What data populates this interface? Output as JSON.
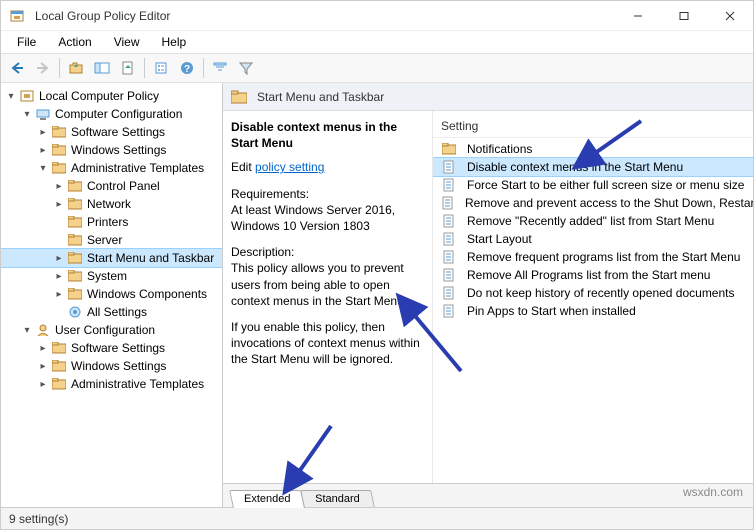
{
  "window": {
    "title": "Local Group Policy Editor"
  },
  "menus": [
    "File",
    "Action",
    "View",
    "Help"
  ],
  "tree": {
    "root": "Local Computer Policy",
    "computer": "Computer Configuration",
    "cc_soft": "Software Settings",
    "cc_win": "Windows Settings",
    "cc_adm": "Administrative Templates",
    "adm_cp": "Control Panel",
    "adm_net": "Network",
    "adm_prn": "Printers",
    "adm_srv": "Server",
    "adm_start": "Start Menu and Taskbar",
    "adm_sys": "System",
    "adm_wc": "Windows Components",
    "adm_all": "All Settings",
    "user": "User Configuration",
    "uc_soft": "Software Settings",
    "uc_win": "Windows Settings",
    "uc_adm": "Administrative Templates"
  },
  "header": "Start Menu and Taskbar",
  "desc": {
    "title": "Disable context menus in the Start Menu",
    "edit_prefix": "Edit ",
    "edit_link": "policy setting",
    "req_h": "Requirements:",
    "req_1": "At least Windows Server 2016,",
    "req_2": "Windows 10 Version 1803",
    "d_h": "Description:",
    "d_1": "This policy allows you to prevent users from being able to open context menus in the Start Menu.",
    "d_2": "If you enable this policy, then invocations of context menus within the Start Menu will be ignored."
  },
  "list": {
    "header": "Setting",
    "items": [
      "Notifications",
      "Disable context menus in the Start Menu",
      "Force Start to be either full screen size or menu size",
      "Remove and prevent access to the Shut Down, Restart,",
      "Remove \"Recently added\" list from Start Menu",
      "Start Layout",
      "Remove frequent programs list from the Start Menu",
      "Remove All Programs list from the Start menu",
      "Do not keep history of recently opened documents",
      "Pin Apps to Start when installed"
    ],
    "selected": 1,
    "folder_indices": [
      0
    ]
  },
  "tabs": {
    "extended": "Extended",
    "standard": "Standard"
  },
  "status": "9 setting(s)",
  "watermark": "wsxdn.com"
}
